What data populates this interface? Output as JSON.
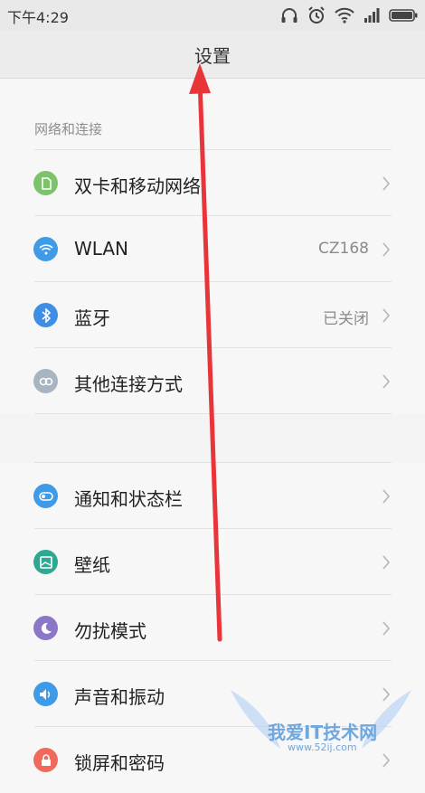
{
  "status_bar": {
    "time": "下午4:29",
    "icons": [
      "headphones-icon",
      "alarm-icon",
      "wifi-icon",
      "signal-icon",
      "battery-icon"
    ]
  },
  "header": {
    "title": "设置"
  },
  "sections": [
    {
      "header": "网络和连接",
      "items": [
        {
          "label": "双卡和移动网络",
          "value": "",
          "icon": "sim-card-icon",
          "color": "#7cc36b"
        },
        {
          "label": "WLAN",
          "value": "CZ168",
          "icon": "wifi-icon",
          "color": "#3f9ae8"
        },
        {
          "label": "蓝牙",
          "value": "已关闭",
          "icon": "bluetooth-icon",
          "color": "#3f8ee6"
        },
        {
          "label": "其他连接方式",
          "value": "",
          "icon": "link-icon",
          "color": "#a9b4c2"
        }
      ]
    },
    {
      "header": "",
      "items": [
        {
          "label": "通知和状态栏",
          "value": "",
          "icon": "toggle-icon",
          "color": "#3f9ae8"
        },
        {
          "label": "壁纸",
          "value": "",
          "icon": "wallpaper-icon",
          "color": "#2ea890"
        },
        {
          "label": "勿扰模式",
          "value": "",
          "icon": "moon-icon",
          "color": "#8b76c7"
        },
        {
          "label": "声音和振动",
          "value": "",
          "icon": "speaker-icon",
          "color": "#3f9ae8"
        },
        {
          "label": "锁屏和密码",
          "value": "",
          "icon": "lock-icon",
          "color": "#ef6a5b"
        }
      ]
    }
  ],
  "watermark": {
    "text": "我爱IT技术网",
    "url": "www.52ij.com"
  },
  "annotation": {
    "arrow_color": "#e8353a"
  }
}
